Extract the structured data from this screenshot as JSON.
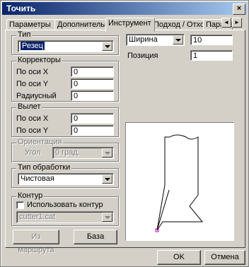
{
  "window": {
    "title": "Точить",
    "close_glyph": "×"
  },
  "tabs": [
    {
      "label": "Параметры",
      "active": false
    },
    {
      "label": "Дополнительные",
      "active": false
    },
    {
      "label": "Инструмент",
      "active": true
    },
    {
      "label": "Подход / Отход",
      "active": false
    },
    {
      "label": "Парамет",
      "active": false
    }
  ],
  "tab_scroll": {
    "left": "◄",
    "right": "►"
  },
  "type_group": {
    "legend": "Тип",
    "value": "Резец"
  },
  "correctors": {
    "legend": "Корректоры",
    "rows": [
      {
        "label": "По оси X",
        "value": "0"
      },
      {
        "label": "По оси Y",
        "value": "0"
      },
      {
        "label": "Радиусный",
        "value": "0"
      }
    ]
  },
  "overhang": {
    "legend": "Вылет",
    "rows": [
      {
        "label": "По оси X",
        "value": "0"
      },
      {
        "label": "По оси Y",
        "value": "0"
      }
    ]
  },
  "orientation": {
    "legend": "Ориентация",
    "label": "Угол",
    "value": "0 град."
  },
  "machining_type": {
    "legend": "Тип обработки",
    "value": "Чистовая"
  },
  "contour": {
    "legend": "Контур",
    "checkbox_label": "Использовать контур",
    "checked": false,
    "file": "cutter1.cat"
  },
  "right": {
    "param_select": "Ширина",
    "param_value": "10",
    "position_label": "Позиция",
    "position_value": "1"
  },
  "buttons": {
    "from_route": "Из маршрута",
    "base": "База",
    "ok": "OK",
    "cancel": "Отмена"
  }
}
